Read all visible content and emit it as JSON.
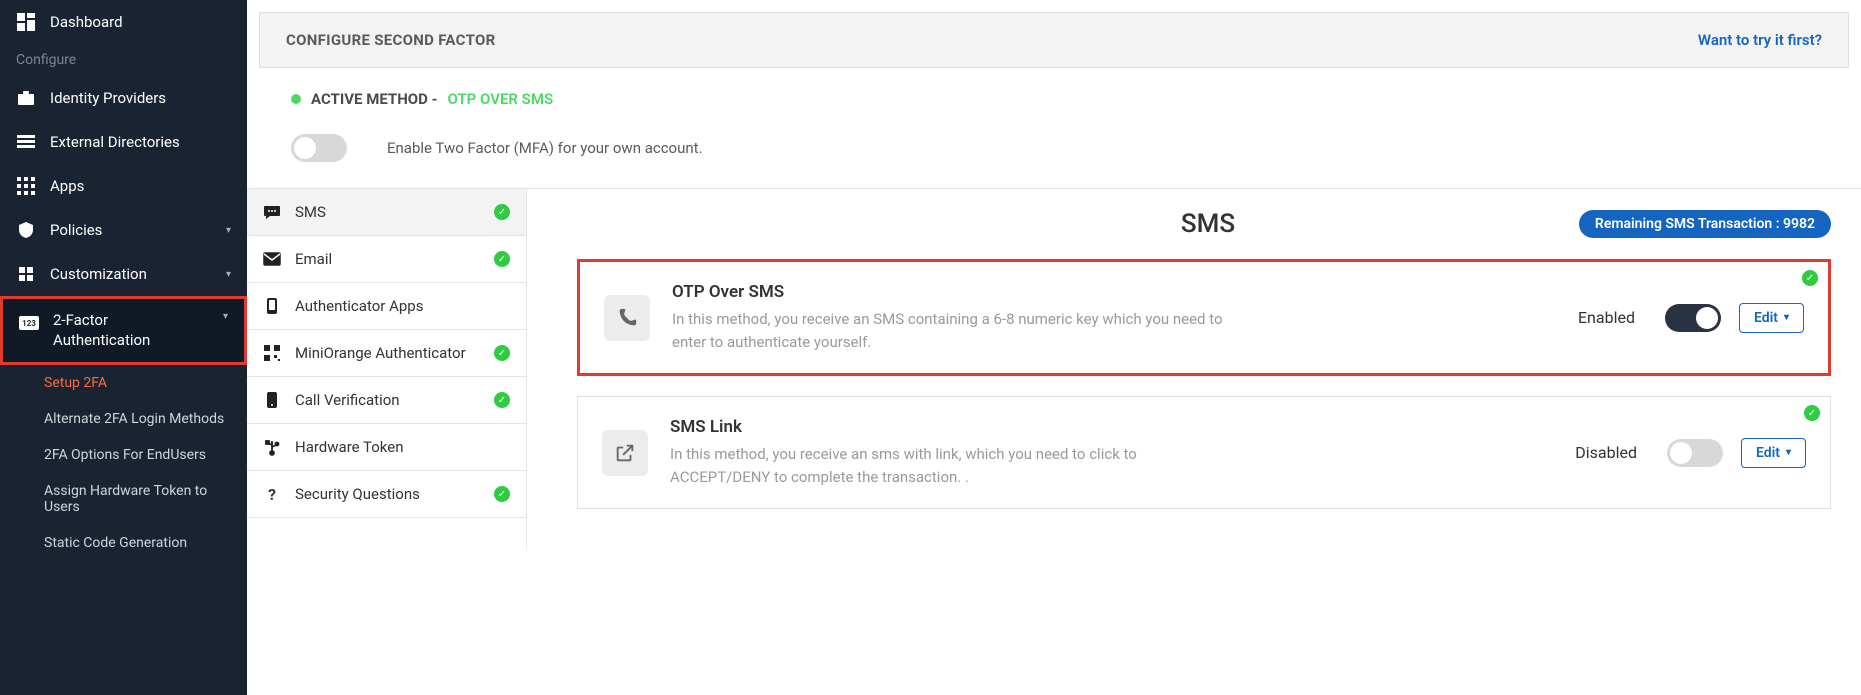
{
  "sidebar": {
    "dashboard": "Dashboard",
    "configure_label": "Configure",
    "identity_providers": "Identity Providers",
    "external_directories": "External Directories",
    "apps": "Apps",
    "policies": "Policies",
    "customization": "Customization",
    "two_factor_auth": "2-Factor Authentication",
    "sub": {
      "setup_2fa": "Setup 2FA",
      "alternate_methods": "Alternate 2FA Login Methods",
      "options_endusers": "2FA Options For EndUsers",
      "assign_hardware": "Assign Hardware Token to Users",
      "static_code": "Static Code Generation"
    }
  },
  "header": {
    "title": "CONFIGURE SECOND FACTOR",
    "try_link": "Want to try it first?"
  },
  "active_method": {
    "label": "ACTIVE METHOD - ",
    "value": "OTP OVER SMS"
  },
  "enable_toggle": {
    "text": "Enable Two Factor (MFA) for your own account."
  },
  "tabs": {
    "sms": "SMS",
    "email": "Email",
    "authenticator_apps": "Authenticator Apps",
    "miniorange_auth": "MiniOrange Authenticator",
    "call_verification": "Call Verification",
    "hardware_token": "Hardware Token",
    "security_questions": "Security Questions"
  },
  "detail": {
    "title": "SMS",
    "remaining_badge": "Remaining SMS Transaction : 9982",
    "cards": [
      {
        "title": "OTP Over SMS",
        "desc": "In this method, you receive an SMS containing a 6-8 numeric key which you need to enter to authenticate yourself.",
        "status": "Enabled",
        "toggle_on": true,
        "edit": "Edit"
      },
      {
        "title": "SMS Link",
        "desc": "In this method, you receive an sms with link, which you need to click to ACCEPT/DENY to complete the transaction. .",
        "status": "Disabled",
        "toggle_on": false,
        "edit": "Edit"
      }
    ]
  }
}
